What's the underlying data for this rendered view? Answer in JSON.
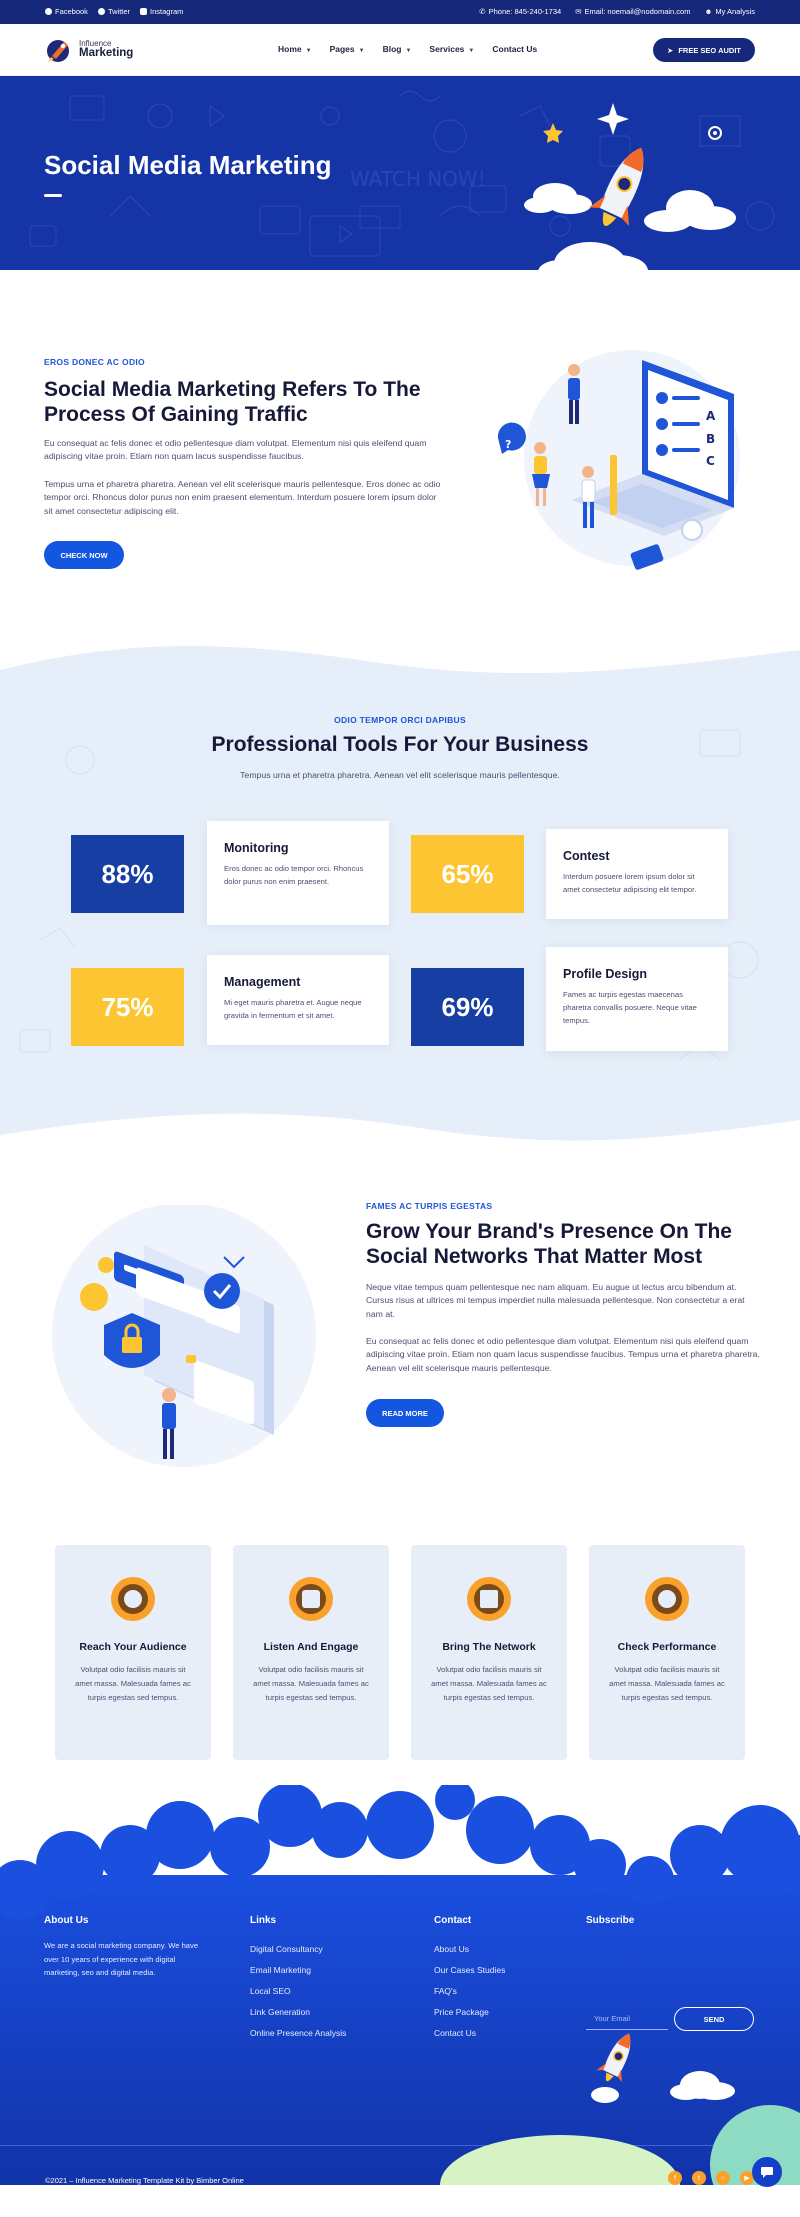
{
  "topbar": {
    "facebook": "Facebook",
    "twitter": "Twitter",
    "instagram": "Instagram",
    "phone": "Phone: 845-240-1734",
    "email": "Email: noemail@nodomain.com",
    "analysis": "My Analysis"
  },
  "header": {
    "logo_line1": "Influence",
    "logo_line2": "Marketing",
    "nav": [
      "Home",
      "Pages",
      "Blog",
      "Services",
      "Contact Us"
    ],
    "cta": "FREE SEO AUDIT"
  },
  "hero": {
    "title": "Social Media Marketing"
  },
  "section1": {
    "eyebrow": "EROS DONEC AC ODIO",
    "title": "Social Media Marketing Refers To The Process Of Gaining Traffic",
    "para1": "Eu consequat ac felis donec et odio pellentesque diam volutpat. Elementum nisi quis eleifend quam adipiscing vitae proin. Etiam non quam lacus suspendisse faucibus.",
    "para2": "Tempus urna et pharetra pharetra. Aenean vel elit scelerisque mauris pellentesque. Eros donec ac odio tempor orci. Rhoncus dolor purus non enim praesent elementum. Interdum posuere lorem ipsum dolor sit amet consectetur adipiscing elit.",
    "button": "CHECK NOW"
  },
  "tools": {
    "eyebrow": "ODIO TEMPOR ORCI DAPIBUS",
    "title": "Professional Tools For Your Business",
    "subtitle": "Tempus urna et pharetra pharetra. Aenean vel elit scelerisque mauris pellentesque.",
    "items": [
      {
        "percent": "88%",
        "title": "Monitoring",
        "desc": "Eros donec ac odio tempor orci. Rhoncus dolor purus non enim praesent."
      },
      {
        "percent": "65%",
        "title": "Contest",
        "desc": "Interdum posuere lorem ipsum dolor sit amet consectetur adipiscing elit tempor."
      },
      {
        "percent": "75%",
        "title": "Management",
        "desc": "Mi eget mauris pharetra et. Augue neque gravida in fermentum et sit amet."
      },
      {
        "percent": "69%",
        "title": "Profile Design",
        "desc": "Fames ac turpis egestas maecenas pharetra convallis posuere. Neque vitae tempus."
      }
    ]
  },
  "section3": {
    "eyebrow": "FAMES AC TURPIS EGESTAS",
    "title": "Grow Your Brand's Presence On The Social Networks That Matter Most",
    "para1": "Neque vitae tempus quam pellentesque nec nam aliquam. Eu augue ut lectus arcu bibendum at. Cursus risus at ultrices mi tempus imperdiet nulla malesuada pellentesque. Non consectetur a erat nam at.",
    "para2": "Eu consequat ac felis donec et odio pellentesque diam volutpat. Elementum nisi quis eleifend quam adipiscing vitae proin. Etiam non quam lacus suspendisse faucibus. Tempus urna et pharetra pharetra. Aenean vel elit scelerisque mauris pellentesque.",
    "button": "READ MORE"
  },
  "features": [
    {
      "title": "Reach Your Audience",
      "desc": "Volutpat odio facilisis mauris sit amet massa. Malesuada fames ac turpis egestas sed tempus."
    },
    {
      "title": "Listen And Engage",
      "desc": "Volutpat odio facilisis mauris sit amet massa. Malesuada fames ac turpis egestas sed tempus."
    },
    {
      "title": "Bring The Network",
      "desc": "Volutpat odio facilisis mauris sit amet massa. Malesuada fames ac turpis egestas sed tempus."
    },
    {
      "title": "Check Performance",
      "desc": "Volutpat odio facilisis mauris sit amet massa. Malesuada fames ac turpis egestas sed tempus."
    }
  ],
  "footer": {
    "about_title": "About Us",
    "about_text": "We are a social marketing company. We have over 10 years of experience with digital marketing, seo and digital media.",
    "links_title": "Links",
    "links": [
      "Digital Consultancy",
      "Email Marketing",
      "Local SEO",
      "Link Generation",
      "Online Presence Analysis"
    ],
    "contact_title": "Contact",
    "contact_links": [
      "About Us",
      "Our Cases Studies",
      "FAQ's",
      "Price Package",
      "Contact Us"
    ],
    "subscribe_title": "Subscribe",
    "email_placeholder": "Your Email",
    "send": "SEND",
    "copyright": "©2021 – Influence Marketing Template Kit by Bimber Online"
  },
  "colors": {
    "navy": "#15287a",
    "hero_blue": "#1534a6",
    "accent_blue": "#1356e0",
    "yellow": "#fcc531",
    "orange": "#f9a12a",
    "light_bg": "#e8eef8"
  }
}
